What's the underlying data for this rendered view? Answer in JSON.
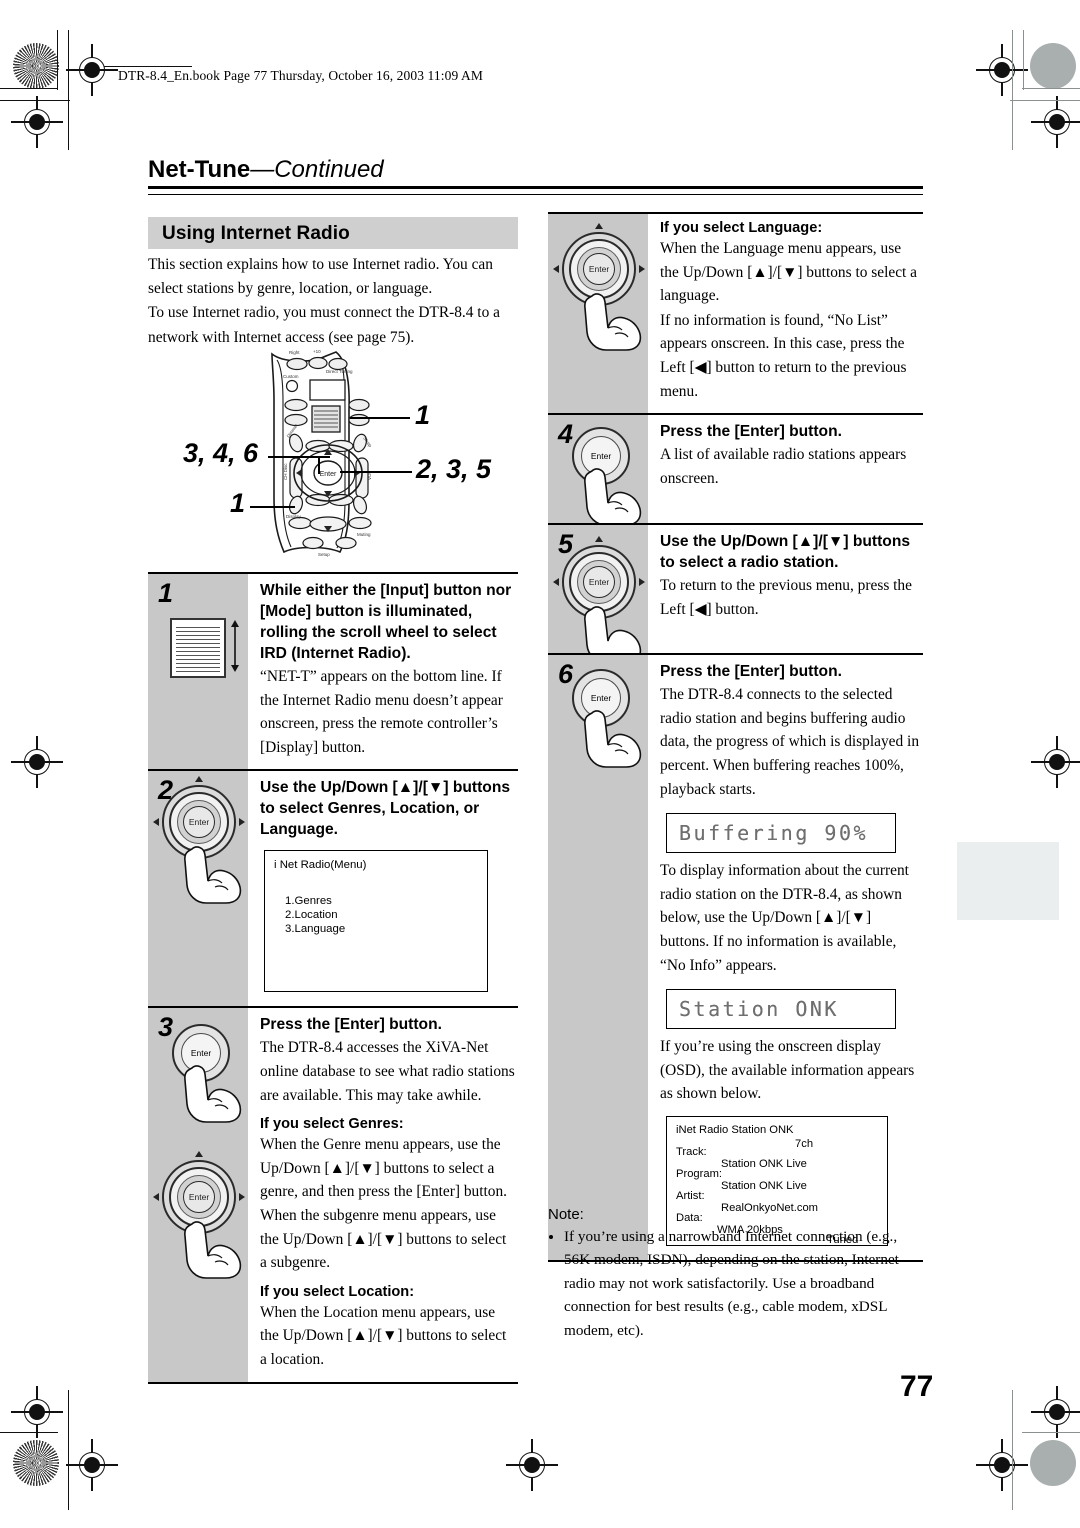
{
  "page": {
    "file_header": "DTR-8.4_En.book  Page 77  Thursday, October 16, 2003  11:09 AM",
    "chapter_title": "Net-Tune",
    "chapter_suffix": "—Continued",
    "section_title": "Using Internet Radio",
    "page_number": "77"
  },
  "intro": {
    "p1": "This section explains how to use Internet radio. You can select stations by genre, location, or language.",
    "p2": "To use Internet radio, you must connect the DTR-8.4 to a network with Internet access (see page 75)."
  },
  "remote": {
    "callout_scroll": "1",
    "callout_left": "3, 4, 6",
    "callout_right": "2, 3, 5",
    "callout_display": "1",
    "enter_label": "Enter"
  },
  "steps_left": [
    {
      "num": "1",
      "heading": "While either the [Input] button nor [Mode] button is illuminated, rolling the scroll wheel to select IRD (Internet Radio).",
      "body": "“NET-T” appears on the bottom line. If the Internet Radio menu doesn’t appear onscreen, press the remote controller’s [Display] button."
    },
    {
      "num": "2",
      "heading": "Use the Up/Down [▲]/[▼] buttons to select Genres, Location, or Language.",
      "menu": {
        "title": "i Net Radio(Menu)",
        "item1": "1.Genres",
        "item2": "2.Location",
        "item3": "3.Language"
      }
    },
    {
      "num": "3",
      "heading": "Press the [Enter] button.",
      "body": "The DTR-8.4 accesses the XiVA-Net online database to see what radio stations are available. This may take awhile.",
      "sub1_title": "If you select Genres:",
      "sub1_body": "When the Genre menu appears, use the Up/Down [▲]/[▼] buttons to select a genre, and then press the [Enter] button. When the subgenre menu appears, use the Up/Down [▲]/[▼] buttons to select a subgenre.",
      "sub2_title": "If you select Location:",
      "sub2_body": "When the Location menu appears, use the Up/Down [▲]/[▼] buttons to select a location."
    }
  ],
  "steps_right": [
    {
      "num": "",
      "sub_title": "If you select Language:",
      "body1": "When the Language menu appears, use the Up/Down [▲]/[▼] buttons to select a language.",
      "body2": "If no information is found, “No List” appears onscreen. In this case, press the Left [◀] button to return to the previous menu."
    },
    {
      "num": "4",
      "heading": "Press the [Enter] button.",
      "body": "A list of available radio stations appears onscreen."
    },
    {
      "num": "5",
      "heading": "Use the Up/Down [▲]/[▼] buttons to select a radio station.",
      "body": "To return to the previous menu, press the Left [◀] button."
    },
    {
      "num": "6",
      "heading": "Press the [Enter] button.",
      "body": "The DTR-8.4 connects to the selected radio station and begins buffering audio data, the progress of which is displayed in percent. When buffering reaches 100%, playback starts.",
      "lcd1": "Buffering 90%",
      "body2": "To display information about the current radio station on the DTR-8.4, as shown below, use the Up/Down [▲]/[▼] buttons. If no information is available, “No Info” appears.",
      "lcd2": "Station ONK",
      "body3": "If you’re using the onscreen display (OSD), the available information appears as shown below.",
      "osd": {
        "title": "iNet Radio Station ONK",
        "channel": "7ch",
        "label_track": "Track:",
        "value_track": "Station ONK Live",
        "label_program": "Program:",
        "value_program": "Station ONK Live",
        "label_artist": "Artist:",
        "value_artist": "RealOnkyoNet.com",
        "label_data": "Data:",
        "value_data": "WMA  20kbps",
        "status": "Tuned"
      }
    }
  ],
  "note": {
    "label": "Note:",
    "item": "If you’re using a narrowband Internet connection (e.g., 56K modem, ISDN), depending on the station, Internet radio may not work satisfactorily. Use a broadband connection for best results (e.g., cable modem, xDSL modem, etc)."
  },
  "colors": {
    "gutter_gray": "#c8c8c8",
    "band_gray": "#cfcfcf",
    "tab_gray": "#eaeeee",
    "lcd_text": "#6f6f6f"
  }
}
